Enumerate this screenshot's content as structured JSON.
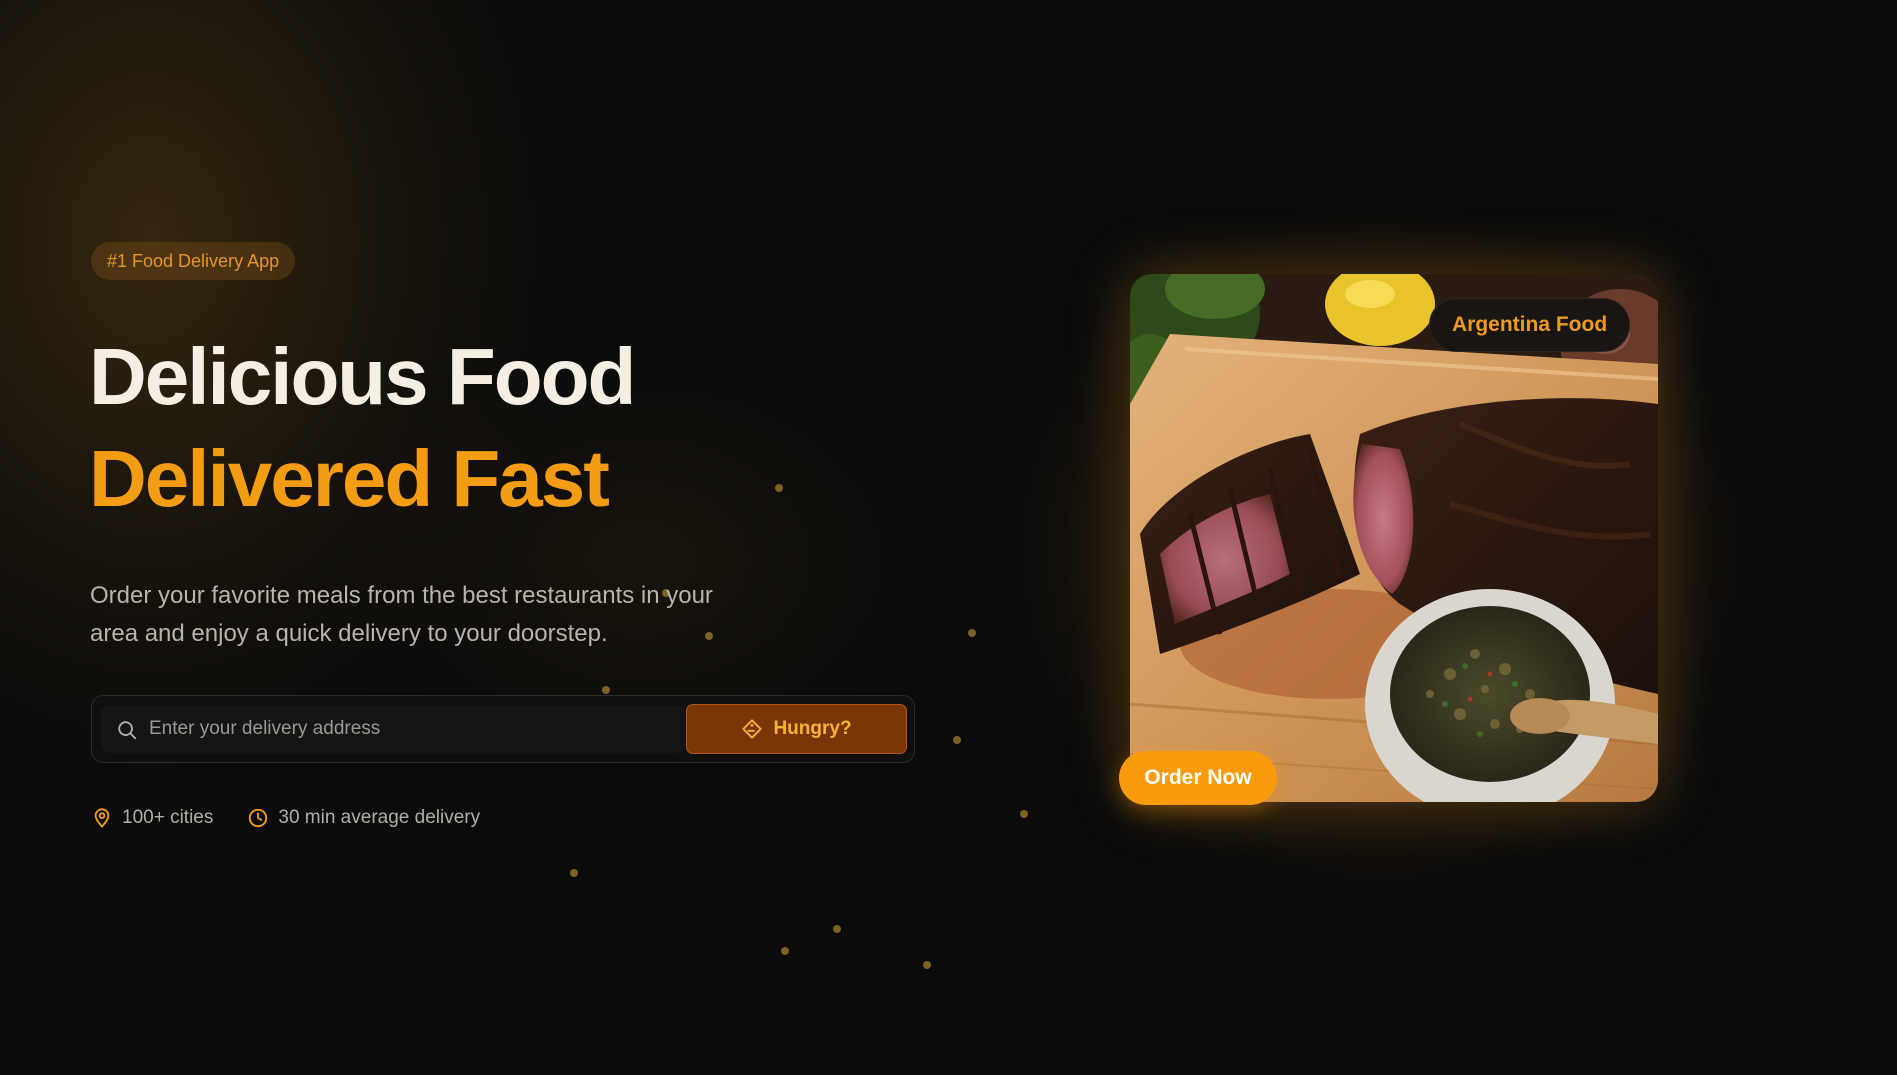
{
  "hero": {
    "badge": "#1 Food Delivery App",
    "headline_line1": "Delicious Food",
    "headline_line2": "Delivered Fast",
    "description": "Order your favorite meals from the best restaurants in your area and enjoy a quick delivery to your doorstep."
  },
  "search": {
    "placeholder": "Enter your delivery address",
    "value": "",
    "button_label": "Hungry?"
  },
  "stats": [
    {
      "icon": "map-pin-icon",
      "label": "100+ cities"
    },
    {
      "icon": "clock-icon",
      "label": "30 min average delivery"
    }
  ],
  "featured": {
    "tag": "Argentina Food",
    "cta_label": "Order Now",
    "image": "sliced-steak-with-chimichurri"
  },
  "colors": {
    "accent": "#f49d12",
    "background": "#0b0b0b",
    "headline": "#f5efe3",
    "button_dark": "#7a3606",
    "cta": "#fa9b0e"
  }
}
